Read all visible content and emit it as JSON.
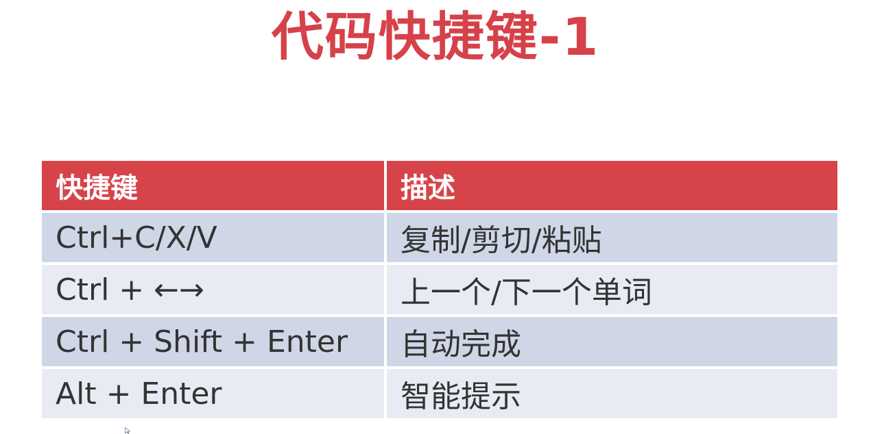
{
  "title": "代码快捷键-1",
  "table": {
    "headers": [
      "快捷键",
      "描述"
    ],
    "rows": [
      {
        "shortcut": "Ctrl+C/X/V",
        "description": "复制/剪切/粘贴"
      },
      {
        "shortcut": "Ctrl + ←→",
        "description": "上一个/下一个单词"
      },
      {
        "shortcut": "Ctrl + Shift + Enter",
        "description": "自动完成"
      },
      {
        "shortcut": "Alt + Enter",
        "description": "智能提示"
      }
    ]
  },
  "colors": {
    "accent": "#d6414a",
    "row_dark": "#cfd6e6",
    "row_light": "#e8ebf3"
  },
  "icons": {
    "cursor": "mouse-pointer-icon"
  }
}
